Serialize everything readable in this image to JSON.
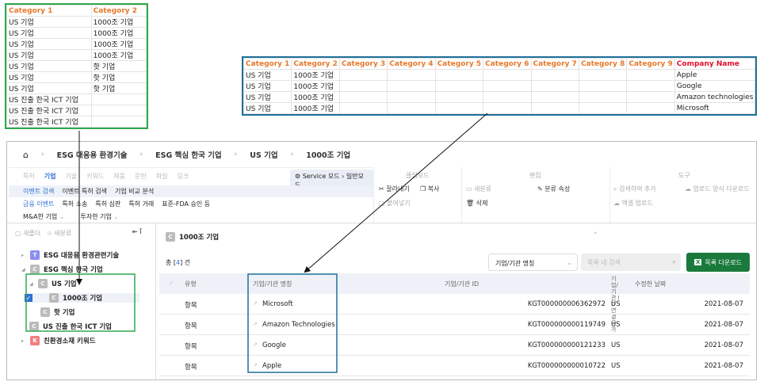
{
  "sheet1": {
    "headers": [
      "Category 1",
      "Category 2"
    ],
    "rows": [
      [
        "US 기업",
        "1000조 기업"
      ],
      [
        "US 기업",
        "1000조 기업"
      ],
      [
        "US 기업",
        "1000조 기업"
      ],
      [
        "US 기업",
        "1000조 기업"
      ],
      [
        "US 기업",
        "핫 기업"
      ],
      [
        "US 기업",
        "핫 기업"
      ],
      [
        "US 기업",
        "핫 기업"
      ],
      [
        "US 진출 한국 ICT 기업",
        ""
      ],
      [
        "US 진출 한국 ICT 기업",
        ""
      ],
      [
        "US 진출 한국 ICT 기업",
        ""
      ]
    ]
  },
  "sheet2": {
    "headers": [
      "Category 1",
      "Category 2",
      "Category 3",
      "Category 4",
      "Category 5",
      "Category 6",
      "Category 7",
      "Category 8",
      "Category 9",
      "Company Name"
    ],
    "rows": [
      [
        "US 기업",
        "1000조 기업",
        "",
        "",
        "",
        "",
        "",
        "",
        "",
        "Apple"
      ],
      [
        "US 기업",
        "1000조 기업",
        "",
        "",
        "",
        "",
        "",
        "",
        "",
        "Google"
      ],
      [
        "US 기업",
        "1000조 기업",
        "",
        "",
        "",
        "",
        "",
        "",
        "",
        "Amazon technologies"
      ],
      [
        "US 기업",
        "1000조 기업",
        "",
        "",
        "",
        "",
        "",
        "",
        "",
        "Microsoft"
      ]
    ]
  },
  "breadcrumb": [
    "ESG 대응용 환경기술",
    "ESG 핵심 한국 기업",
    "US 기업",
    "1000조 기업"
  ],
  "tabs": [
    "특허",
    "기업",
    "기술",
    "키워드",
    "제품",
    "문헌",
    "파일",
    "링크"
  ],
  "mode": {
    "label": "Service 모드",
    "value": "일반모드"
  },
  "submenu1": [
    "이벤트 검색",
    "이벤트 특허 검색",
    "기업 비교 분석"
  ],
  "submenu2": [
    "금융 이벤트",
    "특허 소송",
    "특허 심판",
    "특허 거래",
    "표준-FDA 승인 등"
  ],
  "submenu3": [
    "M&A한 기업",
    "투자한 기업"
  ],
  "toolbar": {
    "clipboard": "클립보드",
    "cut": "잘라내기",
    "copy": "복사",
    "paste": "붙여넣기",
    "edit": "편집",
    "new_class": "새분류",
    "class_attr": "분류 속성",
    "delete": "삭제",
    "tools": "도구",
    "add_term": "검색하여 추가",
    "upload_template": "업로드 양식 다운로드",
    "excel_upload": "엑셀 업로드"
  },
  "tree": {
    "new_folder": "새폴더",
    "new_class": "새분류",
    "nodes": [
      {
        "label": "ESG 대응용 환경관련기술",
        "badge": "T",
        "color": "#8b8ef0"
      },
      {
        "label": "ESG 핵심 한국 기업",
        "badge": "C",
        "color": "#bbbbbb"
      },
      {
        "label": "US 기업",
        "badge": "C",
        "color": "#bbbbbb"
      },
      {
        "label": "1000조 기업",
        "badge": "C",
        "color": "#bbbbbb",
        "checked": true
      },
      {
        "label": "핫 기업",
        "badge": "C",
        "color": "#bbbbbb"
      },
      {
        "label": "US 진출 한국 ICT 기업",
        "badge": "C",
        "color": "#bbbbbb"
      },
      {
        "label": "친환경소재 키워드",
        "badge": "K",
        "color": "#f08080"
      }
    ]
  },
  "panel": {
    "title": "1000조 기업",
    "count_prefix": "총 [",
    "count": "4",
    "count_suffix": "] 건",
    "filter_select": "기업/기관 명칭",
    "search_placeholder": "목록 내 검색",
    "download": "목록 다운로드"
  },
  "table": {
    "headers": [
      "유형",
      "기업/기관 명칭",
      "기업/기관 ID",
      "기업/기관 ID 연결 국가",
      "수정한 날짜"
    ],
    "rows": [
      [
        "항목",
        "Microsoft",
        "KGT000000006362972",
        "US",
        "2021-08-07"
      ],
      [
        "항목",
        "Amazon Technologies",
        "KGT000000000119749",
        "US",
        "2021-08-07"
      ],
      [
        "항목",
        "Google",
        "KGT000000000121233",
        "US",
        "2021-08-07"
      ],
      [
        "항목",
        "Apple",
        "KGT000000000010722",
        "US",
        "2021-08-07"
      ]
    ]
  },
  "colors": {
    "accent": "#2f6fd6",
    "download": "#1a7a3c",
    "sheet_header": "#e8792b",
    "company_header": "#e0102a"
  }
}
